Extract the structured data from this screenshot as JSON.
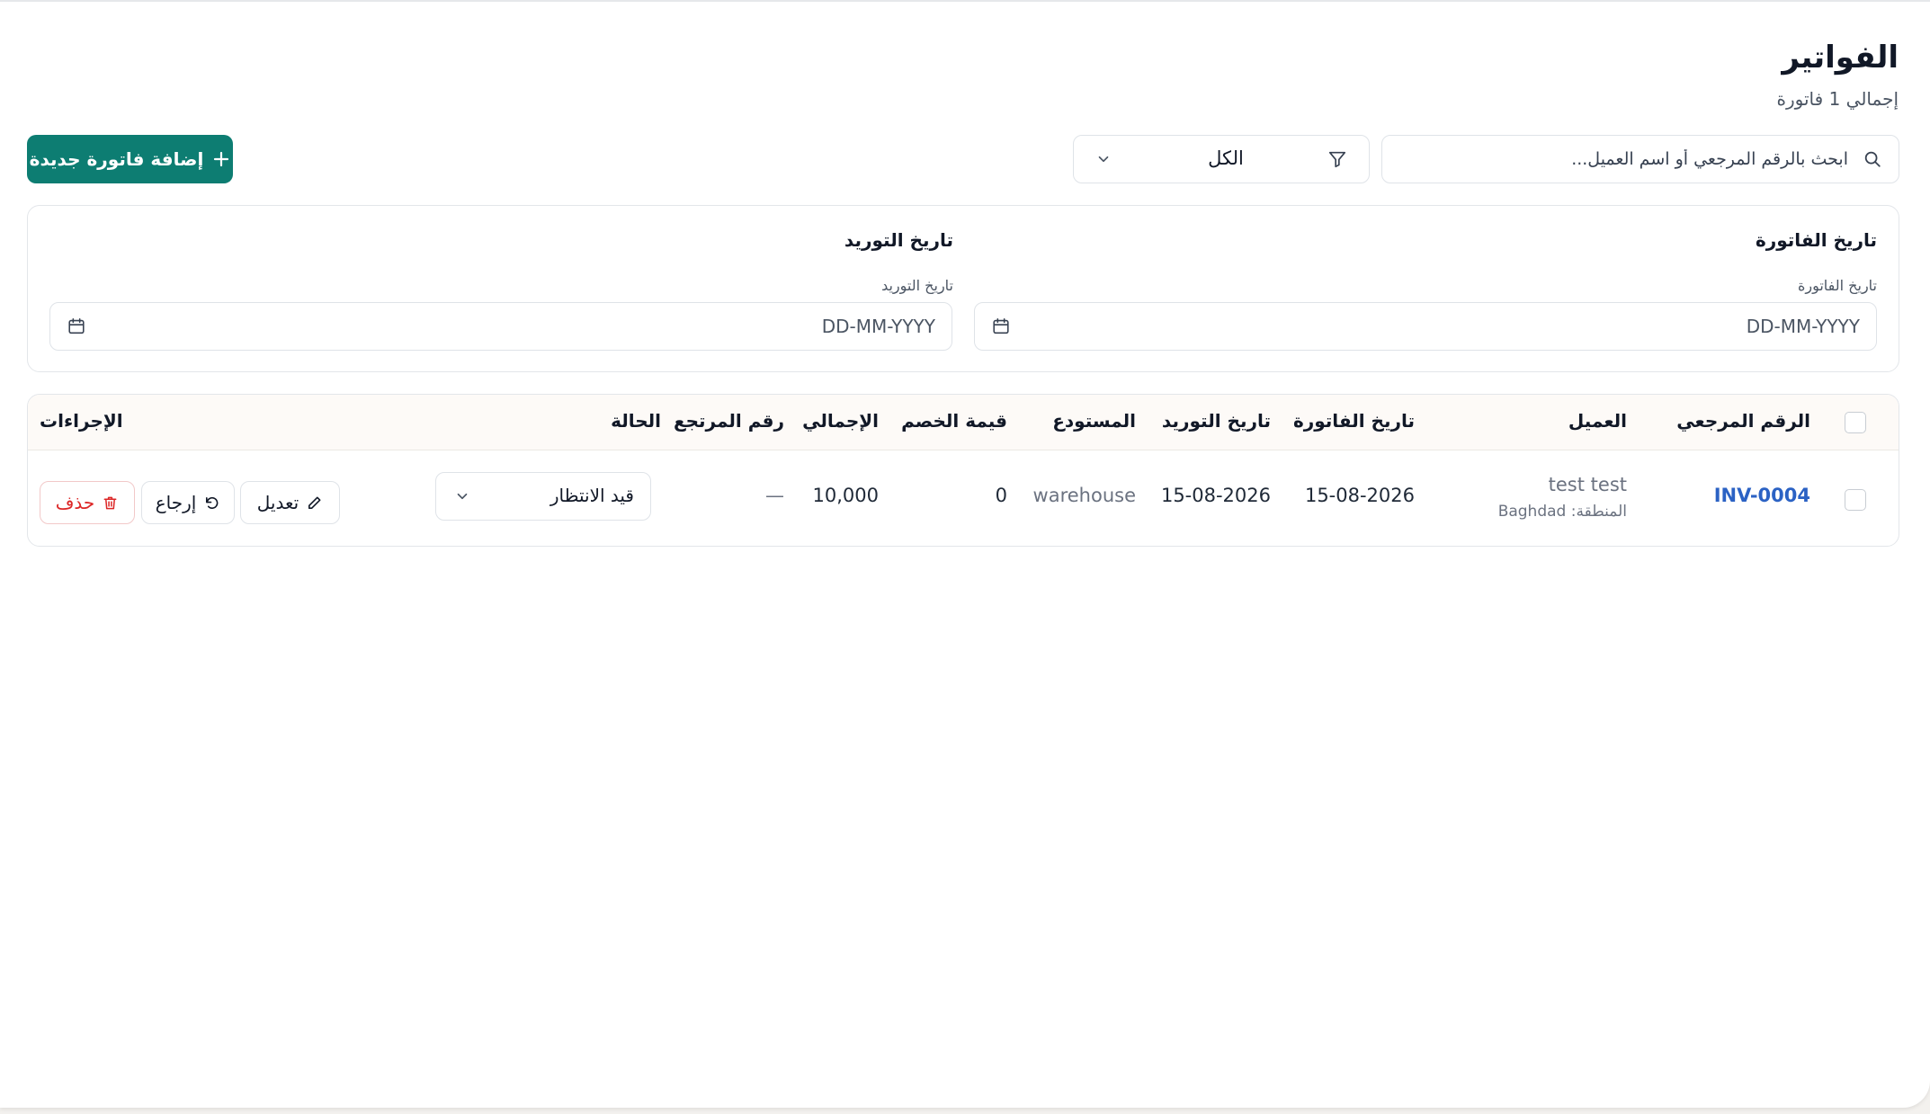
{
  "header": {
    "title": "الفواتير",
    "subtitle": "إجمالي 1 فاتورة"
  },
  "toolbar": {
    "add_button_label": "إضافة فاتورة جديدة",
    "search_placeholder": "ابحث بالرقم المرجعي أو اسم العميل...",
    "filter_value": "الكل"
  },
  "date_filters": {
    "invoice_date": {
      "heading": "تاريخ الفاتورة",
      "label": "تاريخ الفاتورة",
      "placeholder": "DD-MM-YYYY"
    },
    "supply_date": {
      "heading": "تاريخ التوريد",
      "label": "تاريخ التوريد",
      "placeholder": "DD-MM-YYYY"
    }
  },
  "table": {
    "columns": {
      "reference": "الرقم المرجعي",
      "customer": "العميل",
      "invoice_date": "تاريخ الفاتورة",
      "supply_date": "تاريخ التوريد",
      "warehouse": "المستودع",
      "discount": "قيمة الخصم",
      "total": "الإجمالي",
      "return_number": "رقم المرتجع",
      "status": "الحالة",
      "actions": "الإجراءات"
    },
    "rows": [
      {
        "reference": "INV-0004",
        "customer_name": "test test",
        "customer_region": "المنطقة: Baghdad",
        "invoice_date": "15-08-2026",
        "supply_date": "15-08-2026",
        "warehouse": "warehouse",
        "discount": "0",
        "total": "10,000",
        "return_number": "—",
        "status": "قيد الانتظار",
        "actions": {
          "edit": "تعديل",
          "return": "إرجاع",
          "delete": "حذف"
        }
      }
    ]
  },
  "colors": {
    "primary": "#0d7d72",
    "link": "#2b62c4",
    "danger": "#dc2626"
  }
}
